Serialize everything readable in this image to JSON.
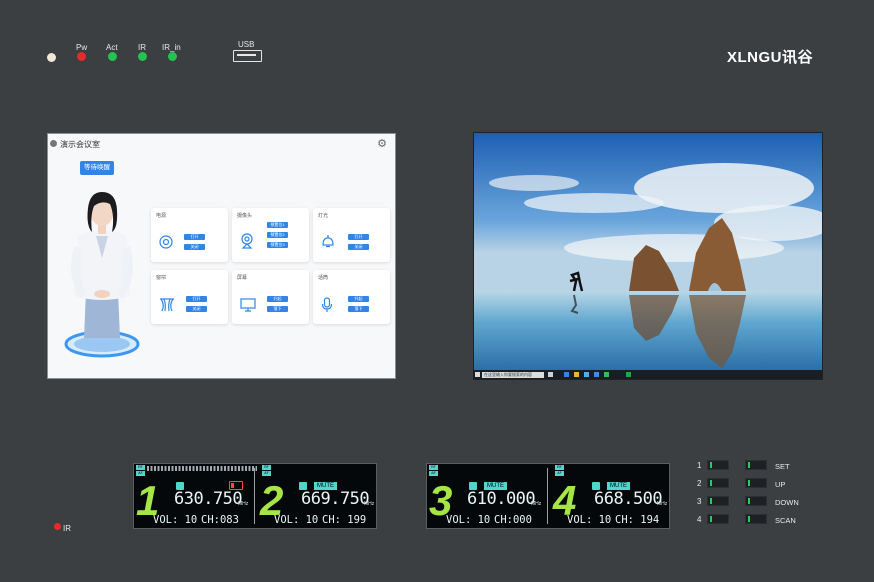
{
  "indicators": [
    {
      "label": "",
      "color": "#f2e6d6"
    },
    {
      "label": "Pw",
      "color": "#e52b2b"
    },
    {
      "label": "Act",
      "color": "#22c34e"
    },
    {
      "label": "IR",
      "color": "#22c34e"
    },
    {
      "label": "IR_in",
      "color": "#22c34e"
    }
  ],
  "usb_label": "USB",
  "brand_name": "XLNGU讯谷",
  "left_screen": {
    "title": "演示会议室",
    "status_button": "等待唤醒",
    "cards": [
      {
        "title": "电源",
        "buttons": [
          "打开",
          "关闭"
        ],
        "icon": "power-icon"
      },
      {
        "title": "摄像头",
        "buttons": [
          "预置位1",
          "预置位2",
          "预置位3"
        ],
        "icon": "camera-icon"
      },
      {
        "title": "灯光",
        "buttons": [
          "打开",
          "关闭"
        ],
        "icon": "light-icon"
      },
      {
        "title": "窗帘",
        "buttons": [
          "打开",
          "关闭"
        ],
        "icon": "curtain-icon"
      },
      {
        "title": "屏幕",
        "buttons": [
          "升起",
          "落下"
        ],
        "icon": "screen-icon"
      },
      {
        "title": "话筒",
        "buttons": [
          "升起",
          "落下"
        ],
        "icon": "microphone-icon"
      }
    ]
  },
  "right_screen": {
    "search_placeholder": "在这里输入你要搜索的内容",
    "clock_time": "",
    "clock_date": ""
  },
  "channels": [
    {
      "num": "1",
      "freq": "630.750",
      "unit": "MHz",
      "vol": "VOL: 10",
      "ch": "CH:083",
      "muted": false,
      "battery_low": true
    },
    {
      "num": "2",
      "freq": "669.750",
      "unit": "MHz",
      "vol": "VOL: 10",
      "ch": "CH: 199",
      "muted": true,
      "battery_low": false
    },
    {
      "num": "3",
      "freq": "610.000",
      "unit": "MHz",
      "vol": "VOL: 10",
      "ch": "CH:000",
      "muted": true,
      "battery_low": false
    },
    {
      "num": "4",
      "freq": "668.500",
      "unit": "MHz",
      "vol": "VOL: 10",
      "ch": "CH: 194",
      "muted": true,
      "battery_low": false
    }
  ],
  "mute_label": "MUTE",
  "ir_label": "IR",
  "status_rows": [
    {
      "num": "1",
      "label": "SET"
    },
    {
      "num": "2",
      "label": "UP"
    },
    {
      "num": "3",
      "label": "DOWN"
    },
    {
      "num": "4",
      "label": "SCAN"
    }
  ]
}
